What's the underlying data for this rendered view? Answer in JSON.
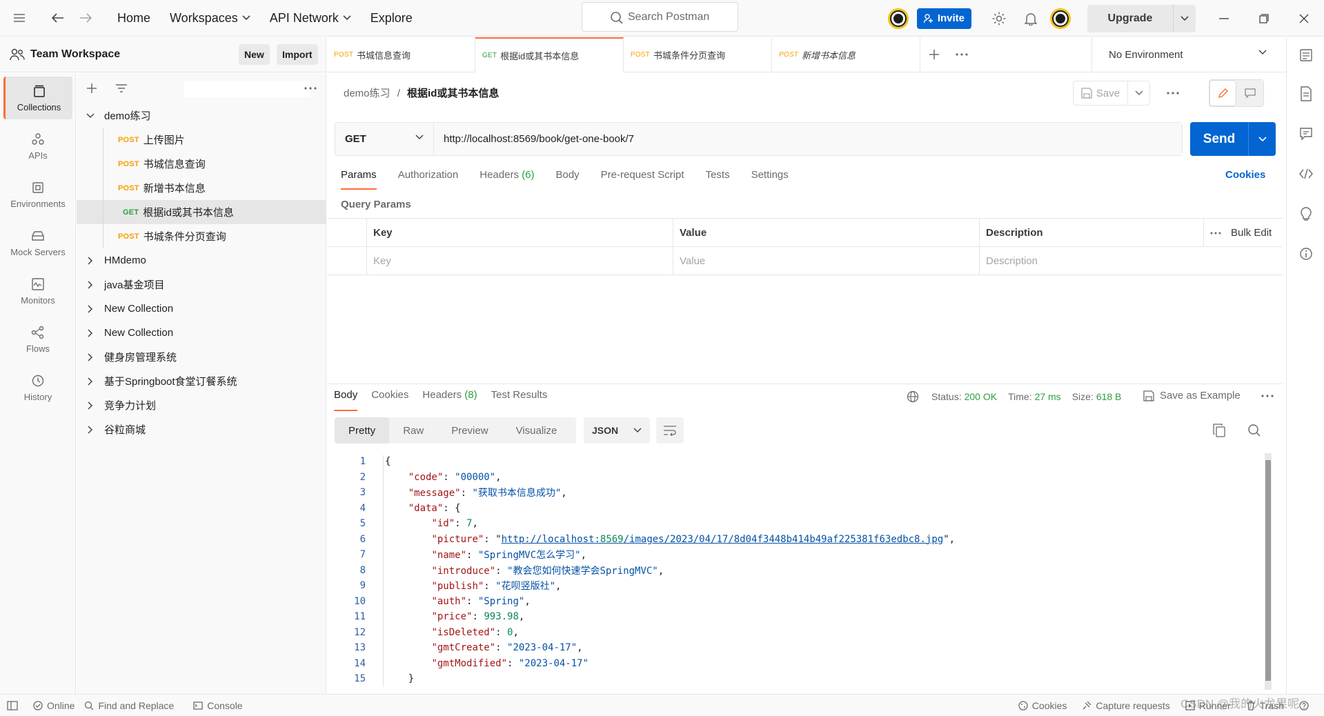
{
  "topbar": {
    "nav": [
      "Home",
      "Workspaces",
      "API Network",
      "Explore"
    ],
    "search_placeholder": "Search Postman",
    "invite_label": "Invite",
    "upgrade_label": "Upgrade"
  },
  "workspace": {
    "name": "Team Workspace",
    "new_label": "New",
    "import_label": "Import"
  },
  "rail": {
    "items": [
      "Collections",
      "APIs",
      "Environments",
      "Mock Servers",
      "Monitors",
      "Flows",
      "History"
    ],
    "active": "Collections"
  },
  "tree": {
    "root": "demo练习",
    "requests": [
      {
        "method": "POST",
        "name": "上传图片"
      },
      {
        "method": "POST",
        "name": "书城信息查询"
      },
      {
        "method": "POST",
        "name": "新增书本信息"
      },
      {
        "method": "GET",
        "name": "根据id或其书本信息"
      },
      {
        "method": "POST",
        "name": "书城条件分页查询"
      }
    ],
    "collections": [
      "HMdemo",
      "java基金项目",
      "New Collection",
      "New Collection",
      "健身房管理系统",
      "基于Springboot食堂订餐系统",
      "竞争力计划",
      "谷粒商城"
    ]
  },
  "tabs": [
    {
      "method": "POST",
      "name": "书城信息查询"
    },
    {
      "method": "GET",
      "name": "根据id或其书本信息"
    },
    {
      "method": "POST",
      "name": "书城条件分页查询"
    },
    {
      "method": "POST",
      "name": "新增书本信息"
    }
  ],
  "environment": "No Environment",
  "request": {
    "breadcrumb_parent": "demo练习",
    "breadcrumb_sep": "/",
    "breadcrumb_current": "根据id或其书本信息",
    "save_label": "Save",
    "method": "GET",
    "url": "http://localhost:8569/book/get-one-book/7",
    "send_label": "Send",
    "tabs": [
      "Params",
      "Authorization",
      "Headers",
      "Body",
      "Pre-request Script",
      "Tests",
      "Settings"
    ],
    "headers_count": "(6)",
    "cookies_label": "Cookies",
    "query_params_title": "Query Params",
    "columns": [
      "Key",
      "Value",
      "Description"
    ],
    "bulk_edit": "Bulk Edit",
    "placeholders": {
      "key": "Key",
      "value": "Value",
      "description": "Description"
    }
  },
  "response": {
    "tabs": [
      "Body",
      "Cookies",
      "Headers",
      "Test Results"
    ],
    "headers_count": "(8)",
    "status_label": "Status:",
    "status_value": "200 OK",
    "time_label": "Time:",
    "time_value": "27 ms",
    "size_label": "Size:",
    "size_value": "618 B",
    "save_example": "Save as Example",
    "views": [
      "Pretty",
      "Raw",
      "Preview",
      "Visualize"
    ],
    "format": "JSON",
    "lines": [
      "{",
      "    \"code\": \"00000\",",
      "    \"message\": \"获取书本信息成功\",",
      "    \"data\": {",
      "        \"id\": 7,",
      "        \"picture\": \"http://localhost:8569/images/2023/04/17/8d04f3448b414b49af225381f63edbc8.jpg\",",
      "        \"name\": \"SpringMVC怎么学习\",",
      "        \"introduce\": \"教会您如何快速学会SpringMVC\",",
      "        \"publish\": \"花呗竖版社\",",
      "        \"auth\": \"Spring\",",
      "        \"price\": 993.98,",
      "        \"isDeleted\": 0,",
      "        \"gmtCreate\": \"2023-04-17\",",
      "        \"gmtModified\": \"2023-04-17\"",
      "    }"
    ]
  },
  "statusbar": {
    "online": "Online",
    "find_replace": "Find and Replace",
    "console": "Console",
    "cookies": "Cookies",
    "capture": "Capture requests",
    "runner": "Runner",
    "trash": "Trash",
    "watermark": "CSDN @我的火龙果呢"
  },
  "colors": {
    "accent": "#ff6c37",
    "primary": "#0265d2",
    "post": "#f5a000",
    "get": "#2e9e3f"
  }
}
